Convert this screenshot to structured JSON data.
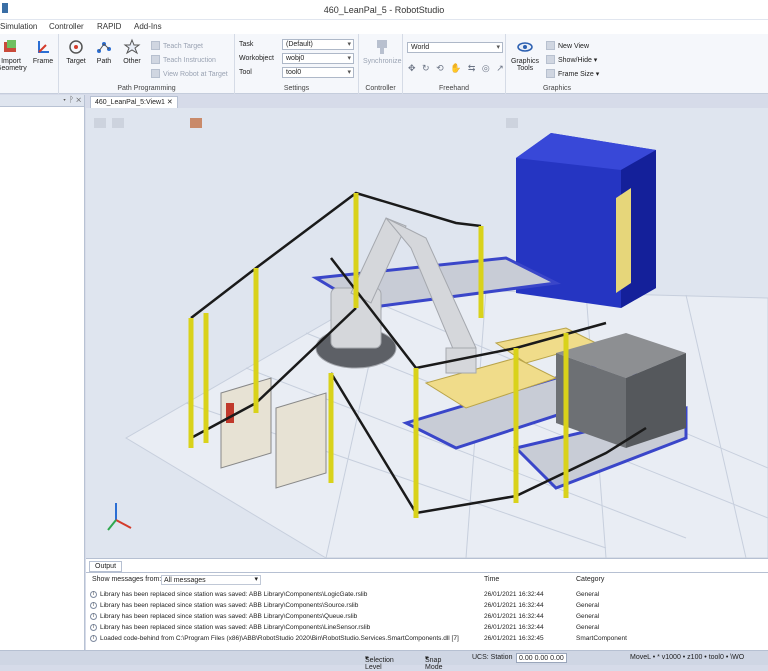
{
  "window": {
    "title": "460_LeanPal_5 - RobotStudio"
  },
  "menu": [
    "Simulation",
    "Controller",
    "RAPID",
    "Add-Ins"
  ],
  "ribbon": {
    "import_geometry": "Import\nGeometry",
    "frame": "Frame",
    "target": "Target",
    "path": "Path",
    "other": "Other",
    "teach_target": "Teach Target",
    "teach_instruction": "Teach Instruction",
    "view_robot_at_target": "View Robot at Target",
    "group_path_programming": "Path Programming",
    "settings": {
      "task_label": "Task",
      "task_value": "(Default)",
      "workobject_label": "Workobject",
      "workobject_value": "wobj0",
      "tool_label": "Tool",
      "tool_value": "tool0",
      "group_label": "Settings"
    },
    "synchronize": "Synchronize",
    "group_controller": "Controller",
    "freehand_combo": "World",
    "group_freehand": "Freehand",
    "graphics_tools": "Graphics\nTools",
    "new_view": "New View",
    "show_hide": "Show/Hide",
    "frame_size": "Frame Size",
    "group_graphics": "Graphics"
  },
  "view_tab": "460_LeanPal_5:View1",
  "output": {
    "tab": "Output",
    "filter_label": "Show messages from:",
    "filter_value": "All messages",
    "col_time": "Time",
    "col_category": "Category",
    "messages": [
      {
        "text": "Library has been replaced since station was saved: ABB Library\\Components\\LogicGate.rslib",
        "time": "26/01/2021 16:32:44",
        "category": "General"
      },
      {
        "text": "Library has been replaced since station was saved: ABB Library\\Components\\Source.rslib",
        "time": "26/01/2021 16:32:44",
        "category": "General"
      },
      {
        "text": "Library has been replaced since station was saved: ABB Library\\Components\\Queue.rslib",
        "time": "26/01/2021 16:32:44",
        "category": "General"
      },
      {
        "text": "Library has been replaced since station was saved: ABB Library\\Components\\LineSensor.rslib",
        "time": "26/01/2021 16:32:44",
        "category": "General"
      },
      {
        "text": "Loaded code-behind from C:\\Program Files (x86)\\ABB\\RobotStudio 2020\\Bin\\RobotStudio.Services.SmartComponents.dll [7]",
        "time": "26/01/2021 16:32:45",
        "category": "SmartComponent"
      }
    ]
  },
  "status": {
    "selection_level": "Selection Level",
    "snap_mode": "Snap Mode",
    "ucs_label": "UCS: Station",
    "coords": "0.00  0.00  0.00",
    "movel": "MoveL • * v1000 • z100 • tool0 • \\WO"
  },
  "colors": {
    "fence": "#1a1a1a",
    "post": "#d9d21a",
    "cabinet": "#1b2fc4",
    "floor": "#dfe5ef",
    "conveyor": "#3a46c9",
    "pallet": "#f0dc8a"
  }
}
